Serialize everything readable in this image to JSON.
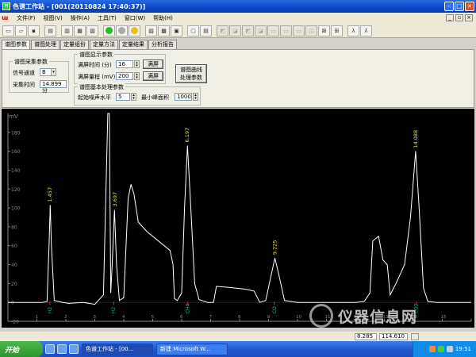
{
  "window": {
    "title": "色谱工作站 - [001(20110824 17:40:37)]"
  },
  "menu": [
    "文件(F)",
    "视图(V)",
    "操作(A)",
    "工具(T)",
    "窗口(W)",
    "帮助(H)"
  ],
  "tabs": [
    "谱图参数",
    "谱图处理",
    "定量组份",
    "定量方法",
    "定量结果",
    "分析报告"
  ],
  "panel": {
    "acq_group": "谱图采集参数",
    "channel_label": "信号通道",
    "channel_value": "B",
    "time_label": "采集时间",
    "time_value": "14.899 分",
    "display_group": "谱图显示参数",
    "full_time_label": "满屏时间 (分)",
    "full_time_value": "16",
    "full_range_label": "满屏量程 (mV)",
    "full_range_value": "200",
    "full_button": "满屏",
    "basic_group": "谱图基本处理参数",
    "start_level_label": "起始噪声水平",
    "start_level_value": "5",
    "min_area_label": "最小峰面积",
    "min_area_value": "1000",
    "save_button_line1": "谱图曲线",
    "save_button_line2": "处理参数"
  },
  "status": {
    "coord_x": "8.285",
    "coord_y": "114.610"
  },
  "taskbar": {
    "start": "开始",
    "tasks": [
      "色谱工作站 - [00...",
      "新建 Microsoft W..."
    ],
    "clock": "19:51"
  },
  "watermark": "仪器信息网",
  "colors": {
    "trace": "#ffffff",
    "peak_label": "#e8e040",
    "axis": "#888888",
    "baseline_marker": "#00d080"
  },
  "chart_data": {
    "type": "line",
    "ylabel": "mV",
    "xlim": [
      0,
      16
    ],
    "ylim": [
      -20,
      200
    ],
    "yticks": [
      -20,
      0,
      20,
      40,
      60,
      80,
      100,
      120,
      140,
      160,
      180
    ],
    "xticks": [
      0,
      1,
      2,
      3,
      4,
      5,
      6,
      7,
      8,
      9,
      10,
      11,
      12,
      13,
      14,
      15,
      16
    ],
    "peak_labels": [
      {
        "x": 1.457,
        "y": 103,
        "text": "1.457"
      },
      {
        "x": 3.697,
        "y": 98,
        "text": "3.697"
      },
      {
        "x": 6.197,
        "y": 166,
        "text": "6.197"
      },
      {
        "x": 9.225,
        "y": 47,
        "text": "9.225"
      },
      {
        "x": 14.088,
        "y": 160,
        "text": "14.088"
      }
    ],
    "baseline_labels": [
      {
        "x": 1.45,
        "text": "H2"
      },
      {
        "x": 3.65,
        "text": "H2"
      },
      {
        "x": 6.2,
        "text": "CH4"
      },
      {
        "x": 9.2,
        "text": "CO"
      },
      {
        "x": 14.1,
        "text": "CO2"
      }
    ],
    "trace": [
      [
        0,
        0
      ],
      [
        1.2,
        0
      ],
      [
        1.35,
        1
      ],
      [
        1.42,
        60
      ],
      [
        1.46,
        103
      ],
      [
        1.5,
        60
      ],
      [
        1.6,
        2
      ],
      [
        1.9,
        0
      ],
      [
        2.1,
        -1
      ],
      [
        2.6,
        0
      ],
      [
        3.0,
        -2
      ],
      [
        3.3,
        8
      ],
      [
        3.45,
        200
      ],
      [
        3.5,
        200
      ],
      [
        3.55,
        10
      ],
      [
        3.6,
        40
      ],
      [
        3.68,
        98
      ],
      [
        3.75,
        40
      ],
      [
        3.85,
        2
      ],
      [
        4.0,
        5
      ],
      [
        4.15,
        110
      ],
      [
        4.25,
        125
      ],
      [
        4.35,
        115
      ],
      [
        4.5,
        85
      ],
      [
        4.8,
        75
      ],
      [
        5.2,
        65
      ],
      [
        5.6,
        55
      ],
      [
        5.7,
        40
      ],
      [
        5.75,
        4
      ],
      [
        5.85,
        2
      ],
      [
        6.0,
        10
      ],
      [
        6.1,
        100
      ],
      [
        6.2,
        166
      ],
      [
        6.3,
        110
      ],
      [
        6.45,
        20
      ],
      [
        6.6,
        3
      ],
      [
        6.9,
        0
      ],
      [
        7.1,
        0
      ],
      [
        7.2,
        17
      ],
      [
        7.6,
        16
      ],
      [
        8.2,
        14
      ],
      [
        8.5,
        12
      ],
      [
        8.7,
        0
      ],
      [
        8.9,
        2
      ],
      [
        9.1,
        30
      ],
      [
        9.22,
        47
      ],
      [
        9.35,
        30
      ],
      [
        9.55,
        2
      ],
      [
        10,
        0
      ],
      [
        11,
        0
      ],
      [
        12,
        0
      ],
      [
        12.3,
        1
      ],
      [
        12.5,
        10
      ],
      [
        12.6,
        65
      ],
      [
        12.8,
        70
      ],
      [
        12.95,
        45
      ],
      [
        13.1,
        40
      ],
      [
        13.2,
        8
      ],
      [
        13.4,
        20
      ],
      [
        13.7,
        40
      ],
      [
        13.9,
        90
      ],
      [
        14.08,
        160
      ],
      [
        14.2,
        100
      ],
      [
        14.35,
        15
      ],
      [
        14.5,
        1
      ],
      [
        14.8,
        0
      ],
      [
        16,
        0
      ]
    ]
  }
}
